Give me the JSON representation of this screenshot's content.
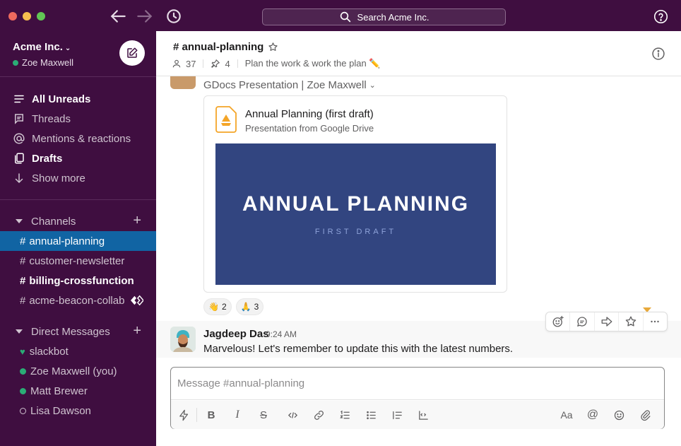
{
  "app": {
    "search_placeholder": "Search Acme Inc."
  },
  "workspace": {
    "name": "Acme Inc.",
    "user": "Zoe Maxwell"
  },
  "nav": {
    "all_unreads": "All Unreads",
    "threads": "Threads",
    "mentions": "Mentions & reactions",
    "drafts": "Drafts",
    "show_more": "Show more"
  },
  "channels": {
    "heading": "Channels",
    "items": [
      {
        "name": "annual-planning"
      },
      {
        "name": "customer-newsletter"
      },
      {
        "name": "billing-crossfunction"
      },
      {
        "name": "acme-beacon-collab"
      }
    ]
  },
  "dms": {
    "heading": "Direct Messages",
    "items": [
      {
        "name": "slackbot"
      },
      {
        "name": "Zoe Maxwell (you)"
      },
      {
        "name": "Matt Brewer"
      },
      {
        "name": "Lisa Dawson"
      }
    ]
  },
  "channel": {
    "title": "# annual-planning",
    "members": "37",
    "pins": "4",
    "topic": "Plan the work & work the plan ✏️"
  },
  "file_message": {
    "source": "GDocs Presentation | Zoe Maxwell",
    "card_title": "Annual Planning (first draft)",
    "card_subtitle": "Presentation from Google Drive",
    "slide_title": "ANNUAL PLANNING",
    "slide_subtitle": "FIRST DRAFT",
    "reactions": [
      {
        "emoji": "👋",
        "count": "2"
      },
      {
        "emoji": "🙏",
        "count": "3"
      }
    ]
  },
  "message": {
    "author": "Jagdeep Das",
    "time": "9:24 AM",
    "text": "Marvelous! Let's remember to update this with the latest numbers."
  },
  "composer": {
    "placeholder": "Message #annual-planning",
    "format_label": "Aa",
    "mention_label": "@"
  },
  "colors": {
    "sidebar": "#3f0e40",
    "active_channel": "#1164a3",
    "presence": "#2bac76",
    "slide_bg": "#324580"
  }
}
